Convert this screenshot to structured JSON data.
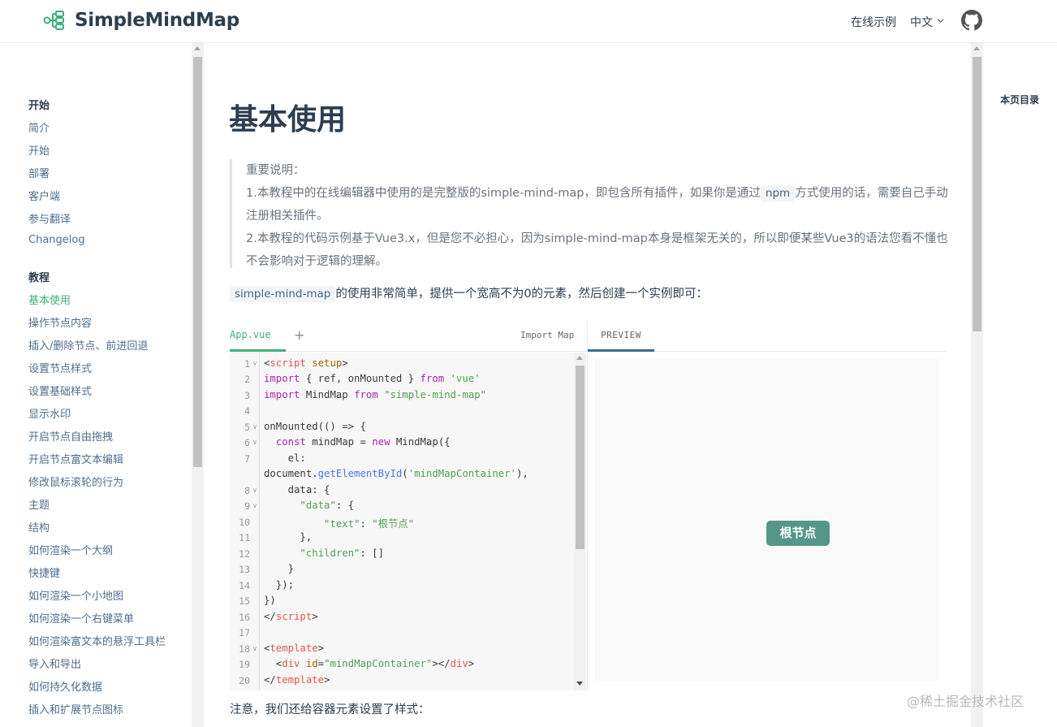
{
  "header": {
    "brand": "SimpleMindMap",
    "nav_online": "在线示例",
    "nav_lang": "中文",
    "github_icon": "github-icon",
    "logo_icon": "mindmap-logo-icon",
    "accent": "#3eaf7c"
  },
  "sidebar": {
    "group1": "开始",
    "group1_items": [
      "简介",
      "开始",
      "部署",
      "客户端",
      "参与翻译",
      "Changelog"
    ],
    "group2": "教程",
    "group2_items": [
      "基本使用",
      "操作节点内容",
      "插入/删除节点、前进回退",
      "设置节点样式",
      "设置基础样式",
      "显示水印",
      "开启节点自由拖拽",
      "开启节点富文本编辑",
      "修改鼠标滚轮的行为",
      "主题",
      "结构",
      "如何渲染一个大纲",
      "快捷键",
      "如何渲染一个小地图",
      "如何渲染一个右键菜单",
      "如何渲染富文本的悬浮工具栏",
      "导入和导出",
      "如何持久化数据",
      "插入和扩展节点图标"
    ],
    "active": "基本使用"
  },
  "main": {
    "title": "基本使用",
    "note_line1": "重要说明：",
    "note_line2a": "1.本教程中的在线编辑器中使用的是完整版的simple-mind-map，即包含所有插件，如果你是通过",
    "note_npm": "npm",
    "note_line2b": "方式使用的话，需要自己手动注册相关插件。",
    "note_line3": "2.本教程的代码示例基于Vue3.x，但是您不必担心，因为simple-mind-map本身是框架无关的，所以即便某些Vue3的语法您看不懂也不会影响对于逻辑的理解。",
    "intro_code": "simple-mind-map",
    "intro_text": "的使用非常简单，提供一个宽高不为0的元素，然后创建一个实例即可：",
    "bottom_text": "注意，我们还给容器元素设置了样式："
  },
  "playground": {
    "tab_file": "App.vue",
    "tab_add": "+",
    "import_map": "Import Map",
    "preview_tab": "PREVIEW",
    "root_node": "根节点",
    "line_numbers": [
      "1",
      "2",
      "3",
      "4",
      "5",
      "6",
      "7",
      "",
      "8",
      "9",
      "10",
      "11",
      "12",
      "13",
      "14",
      "15",
      "16",
      "17",
      "18",
      "19",
      "20"
    ]
  },
  "toc": {
    "title": "本页目录"
  },
  "watermark": "@稀土掘金技术社区"
}
